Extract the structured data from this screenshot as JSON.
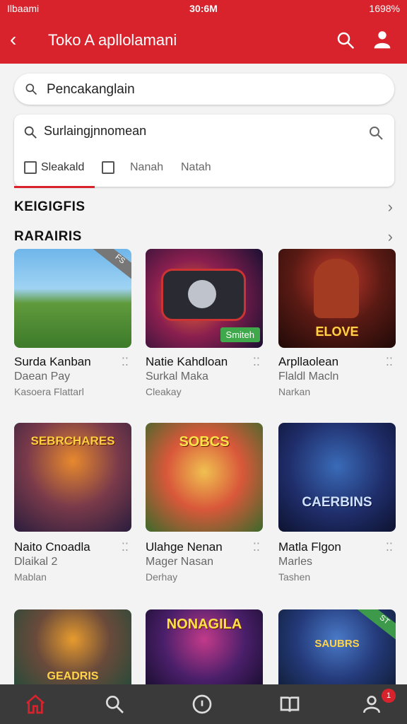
{
  "status": {
    "left": "Ilbaami",
    "time": "30:6M",
    "right": "1698%"
  },
  "appbar": {
    "title": "Toko A apllolamani"
  },
  "search_top": {
    "value": "Pencakanglain"
  },
  "panel": {
    "search_value": "Surlaingjnnomean",
    "tabs": [
      "Sleakald",
      "Nanah",
      "Natah"
    ]
  },
  "sections": [
    "KEIGIGFIS",
    "RARAIRIS"
  ],
  "cards": [
    {
      "name": "Surda Kanban",
      "sub1": "Daean Pay",
      "sub2": "Kasoera Flattarl",
      "art": "",
      "ribbon": "FS",
      "badge": ""
    },
    {
      "name": "Natie Kahdloan",
      "sub1": "Surkal Maka",
      "sub2": "Cleakay",
      "art": "",
      "ribbon": "",
      "badge": "Smiteh"
    },
    {
      "name": "Arpllaolean",
      "sub1": "Flaldl Macln",
      "sub2": "Narkan",
      "art": "ELOVE",
      "ribbon": "",
      "badge": ""
    },
    {
      "name": "Naito Cnoadla",
      "sub1": "Dlaikal 2",
      "sub2": "Mablan",
      "art": "SEBRCHARES",
      "ribbon": "",
      "badge": ""
    },
    {
      "name": "Ulahge Nenan",
      "sub1": "Mager Nasan",
      "sub2": "Derhay",
      "art": "SOBCS",
      "ribbon": "",
      "badge": ""
    },
    {
      "name": "Matla Flgon",
      "sub1": "Marles",
      "sub2": "Tashen",
      "art": "CAERBINS",
      "ribbon": "",
      "badge": ""
    },
    {
      "name": "",
      "sub1": "",
      "sub2": "",
      "art": "GEADRIS",
      "ribbon": "",
      "badge": ""
    },
    {
      "name": "",
      "sub1": "",
      "sub2": "",
      "art": "NONAGILA",
      "ribbon": "",
      "badge": ""
    },
    {
      "name": "",
      "sub1": "",
      "sub2": "",
      "art": "SAUBRS",
      "ribbon": "ST",
      "badge": ""
    }
  ],
  "notification_count": "1",
  "colors": {
    "brand": "#d8232d",
    "nav": "#3a3a3a"
  },
  "icons": [
    "back-icon",
    "search-icon",
    "user-icon",
    "home-icon",
    "compass-icon",
    "book-icon",
    "profile-icon"
  ]
}
